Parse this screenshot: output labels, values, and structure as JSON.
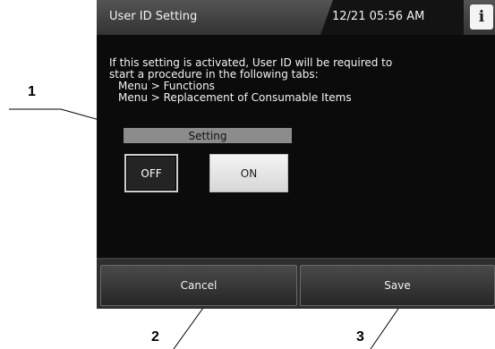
{
  "header": {
    "title": "User ID Setting",
    "datetime": "12/21 05:56 AM",
    "info_icon_glyph": "i"
  },
  "content": {
    "description_lines": [
      "If this setting is activated, User ID will be required to",
      "start a procedure in the following tabs:",
      "Menu > Functions",
      "Menu > Replacement of Consumable Items"
    ],
    "setting_label": "Setting",
    "toggle": {
      "off_label": "OFF",
      "on_label": "ON",
      "selected": "ON"
    }
  },
  "footer": {
    "cancel_label": "Cancel",
    "save_label": "Save"
  },
  "callouts": {
    "c1": "1",
    "c2": "2",
    "c3": "3"
  },
  "icons": {
    "info": "info-icon"
  },
  "colors": {
    "screen_bg": "#0b0b0b",
    "setting_label_bg": "#8c8c8c",
    "on_button_bg": "#e6e6e6"
  }
}
